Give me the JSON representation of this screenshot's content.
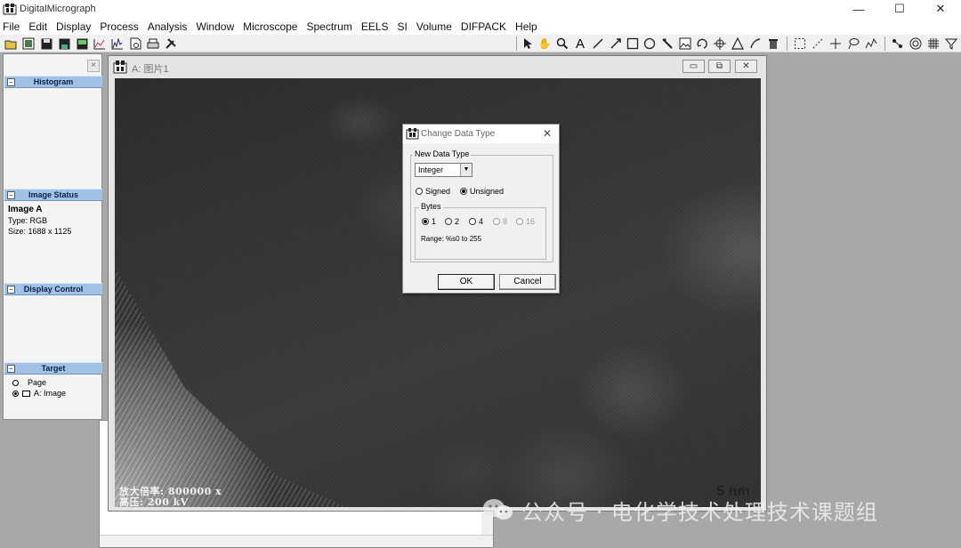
{
  "app": {
    "title": "DigitalMicrograph",
    "window_controls": {
      "minimize": "—",
      "maximize": "☐",
      "close": "✕"
    }
  },
  "menu": [
    "File",
    "Edit",
    "Display",
    "Process",
    "Analysis",
    "Window",
    "Microscope",
    "Spectrum",
    "EELS",
    "SI",
    "Volume",
    "DIFPACK",
    "Help"
  ],
  "toolbar": {
    "left_icons": [
      "open-icon",
      "open-image-icon",
      "save-icon",
      "save-all-icon",
      "save-display-icon",
      "line-plot-icon",
      "profile-icon",
      "page-icon",
      "print-icon",
      "tools-icon"
    ],
    "right_icons": [
      "pointer-icon",
      "hand-icon",
      "zoom-icon",
      "text-icon",
      "line-icon",
      "arrow-line-icon",
      "rectangle-icon",
      "oval-icon",
      "image-roi-icon",
      "rotate-icon",
      "move-icon",
      "spot-icon",
      "measure-icon",
      "trash-icon",
      "rect-roi-icon",
      "line-roi-icon",
      "point-roi-icon",
      "lasso-icon",
      "curve-icon",
      "points-icon",
      "target-icon",
      "mask-icon",
      "filter-icon"
    ]
  },
  "panel": {
    "sections": {
      "histogram": "Histogram",
      "image_status": "Image Status",
      "display_control": "Display Control",
      "target": "Target"
    },
    "image_status": {
      "name": "Image A",
      "type": "Type: RGB",
      "size": "Size:   1688 x 1125"
    },
    "target": {
      "page": "Page",
      "image": "A: Image"
    }
  },
  "image_window": {
    "title": "A: 图片1",
    "caption_mag": "放大倍率:  800000 x",
    "caption_hv": "高压:        200 kV",
    "scale_bar": "5 nm"
  },
  "dialog": {
    "title": "Change Data Type",
    "group_label": "New Data Type",
    "selected_type": "Integer",
    "signed": "Signed",
    "unsigned": "Unsigned",
    "sign_selected": "unsigned",
    "bytes_label": "Bytes",
    "bytes_options": [
      "1",
      "2",
      "4",
      "8",
      "16"
    ],
    "bytes_selected": "1",
    "range": "Range: %s0 to 255",
    "ok": "OK",
    "cancel": "Cancel"
  },
  "watermark": "公众号 · 电化学技术处理技术课题组"
}
